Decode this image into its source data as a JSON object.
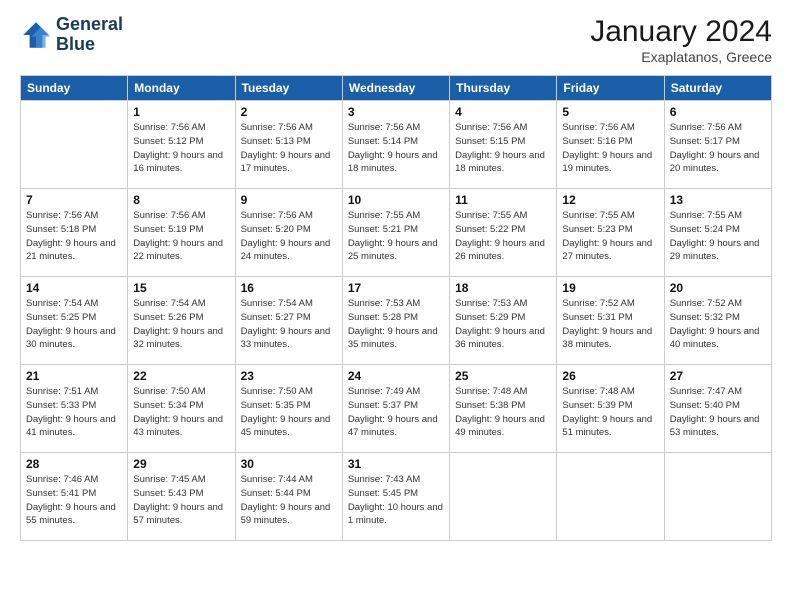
{
  "logo": {
    "line1": "General",
    "line2": "Blue"
  },
  "title": "January 2024",
  "location": "Exaplatanos, Greece",
  "days_header": [
    "Sunday",
    "Monday",
    "Tuesday",
    "Wednesday",
    "Thursday",
    "Friday",
    "Saturday"
  ],
  "weeks": [
    [
      {
        "day": "",
        "sunrise": "",
        "sunset": "",
        "daylight": "",
        "empty": true
      },
      {
        "day": "1",
        "sunrise": "7:56 AM",
        "sunset": "5:12 PM",
        "daylight": "9 hours and 16 minutes.",
        "empty": false
      },
      {
        "day": "2",
        "sunrise": "7:56 AM",
        "sunset": "5:13 PM",
        "daylight": "9 hours and 17 minutes.",
        "empty": false
      },
      {
        "day": "3",
        "sunrise": "7:56 AM",
        "sunset": "5:14 PM",
        "daylight": "9 hours and 18 minutes.",
        "empty": false
      },
      {
        "day": "4",
        "sunrise": "7:56 AM",
        "sunset": "5:15 PM",
        "daylight": "9 hours and 18 minutes.",
        "empty": false
      },
      {
        "day": "5",
        "sunrise": "7:56 AM",
        "sunset": "5:16 PM",
        "daylight": "9 hours and 19 minutes.",
        "empty": false
      },
      {
        "day": "6",
        "sunrise": "7:56 AM",
        "sunset": "5:17 PM",
        "daylight": "9 hours and 20 minutes.",
        "empty": false
      }
    ],
    [
      {
        "day": "7",
        "sunrise": "7:56 AM",
        "sunset": "5:18 PM",
        "daylight": "9 hours and 21 minutes.",
        "empty": false
      },
      {
        "day": "8",
        "sunrise": "7:56 AM",
        "sunset": "5:19 PM",
        "daylight": "9 hours and 22 minutes.",
        "empty": false
      },
      {
        "day": "9",
        "sunrise": "7:56 AM",
        "sunset": "5:20 PM",
        "daylight": "9 hours and 24 minutes.",
        "empty": false
      },
      {
        "day": "10",
        "sunrise": "7:55 AM",
        "sunset": "5:21 PM",
        "daylight": "9 hours and 25 minutes.",
        "empty": false
      },
      {
        "day": "11",
        "sunrise": "7:55 AM",
        "sunset": "5:22 PM",
        "daylight": "9 hours and 26 minutes.",
        "empty": false
      },
      {
        "day": "12",
        "sunrise": "7:55 AM",
        "sunset": "5:23 PM",
        "daylight": "9 hours and 27 minutes.",
        "empty": false
      },
      {
        "day": "13",
        "sunrise": "7:55 AM",
        "sunset": "5:24 PM",
        "daylight": "9 hours and 29 minutes.",
        "empty": false
      }
    ],
    [
      {
        "day": "14",
        "sunrise": "7:54 AM",
        "sunset": "5:25 PM",
        "daylight": "9 hours and 30 minutes.",
        "empty": false
      },
      {
        "day": "15",
        "sunrise": "7:54 AM",
        "sunset": "5:26 PM",
        "daylight": "9 hours and 32 minutes.",
        "empty": false
      },
      {
        "day": "16",
        "sunrise": "7:54 AM",
        "sunset": "5:27 PM",
        "daylight": "9 hours and 33 minutes.",
        "empty": false
      },
      {
        "day": "17",
        "sunrise": "7:53 AM",
        "sunset": "5:28 PM",
        "daylight": "9 hours and 35 minutes.",
        "empty": false
      },
      {
        "day": "18",
        "sunrise": "7:53 AM",
        "sunset": "5:29 PM",
        "daylight": "9 hours and 36 minutes.",
        "empty": false
      },
      {
        "day": "19",
        "sunrise": "7:52 AM",
        "sunset": "5:31 PM",
        "daylight": "9 hours and 38 minutes.",
        "empty": false
      },
      {
        "day": "20",
        "sunrise": "7:52 AM",
        "sunset": "5:32 PM",
        "daylight": "9 hours and 40 minutes.",
        "empty": false
      }
    ],
    [
      {
        "day": "21",
        "sunrise": "7:51 AM",
        "sunset": "5:33 PM",
        "daylight": "9 hours and 41 minutes.",
        "empty": false
      },
      {
        "day": "22",
        "sunrise": "7:50 AM",
        "sunset": "5:34 PM",
        "daylight": "9 hours and 43 minutes.",
        "empty": false
      },
      {
        "day": "23",
        "sunrise": "7:50 AM",
        "sunset": "5:35 PM",
        "daylight": "9 hours and 45 minutes.",
        "empty": false
      },
      {
        "day": "24",
        "sunrise": "7:49 AM",
        "sunset": "5:37 PM",
        "daylight": "9 hours and 47 minutes.",
        "empty": false
      },
      {
        "day": "25",
        "sunrise": "7:48 AM",
        "sunset": "5:38 PM",
        "daylight": "9 hours and 49 minutes.",
        "empty": false
      },
      {
        "day": "26",
        "sunrise": "7:48 AM",
        "sunset": "5:39 PM",
        "daylight": "9 hours and 51 minutes.",
        "empty": false
      },
      {
        "day": "27",
        "sunrise": "7:47 AM",
        "sunset": "5:40 PM",
        "daylight": "9 hours and 53 minutes.",
        "empty": false
      }
    ],
    [
      {
        "day": "28",
        "sunrise": "7:46 AM",
        "sunset": "5:41 PM",
        "daylight": "9 hours and 55 minutes.",
        "empty": false
      },
      {
        "day": "29",
        "sunrise": "7:45 AM",
        "sunset": "5:43 PM",
        "daylight": "9 hours and 57 minutes.",
        "empty": false
      },
      {
        "day": "30",
        "sunrise": "7:44 AM",
        "sunset": "5:44 PM",
        "daylight": "9 hours and 59 minutes.",
        "empty": false
      },
      {
        "day": "31",
        "sunrise": "7:43 AM",
        "sunset": "5:45 PM",
        "daylight": "10 hours and 1 minute.",
        "empty": false
      },
      {
        "day": "",
        "sunrise": "",
        "sunset": "",
        "daylight": "",
        "empty": true
      },
      {
        "day": "",
        "sunrise": "",
        "sunset": "",
        "daylight": "",
        "empty": true
      },
      {
        "day": "",
        "sunrise": "",
        "sunset": "",
        "daylight": "",
        "empty": true
      }
    ]
  ],
  "labels": {
    "sunrise_prefix": "Sunrise: ",
    "sunset_prefix": "Sunset: ",
    "daylight_prefix": "Daylight: "
  },
  "colors": {
    "header_bg": "#1a5fa8",
    "header_text": "#ffffff",
    "empty_cell": "#f5f5f5"
  }
}
